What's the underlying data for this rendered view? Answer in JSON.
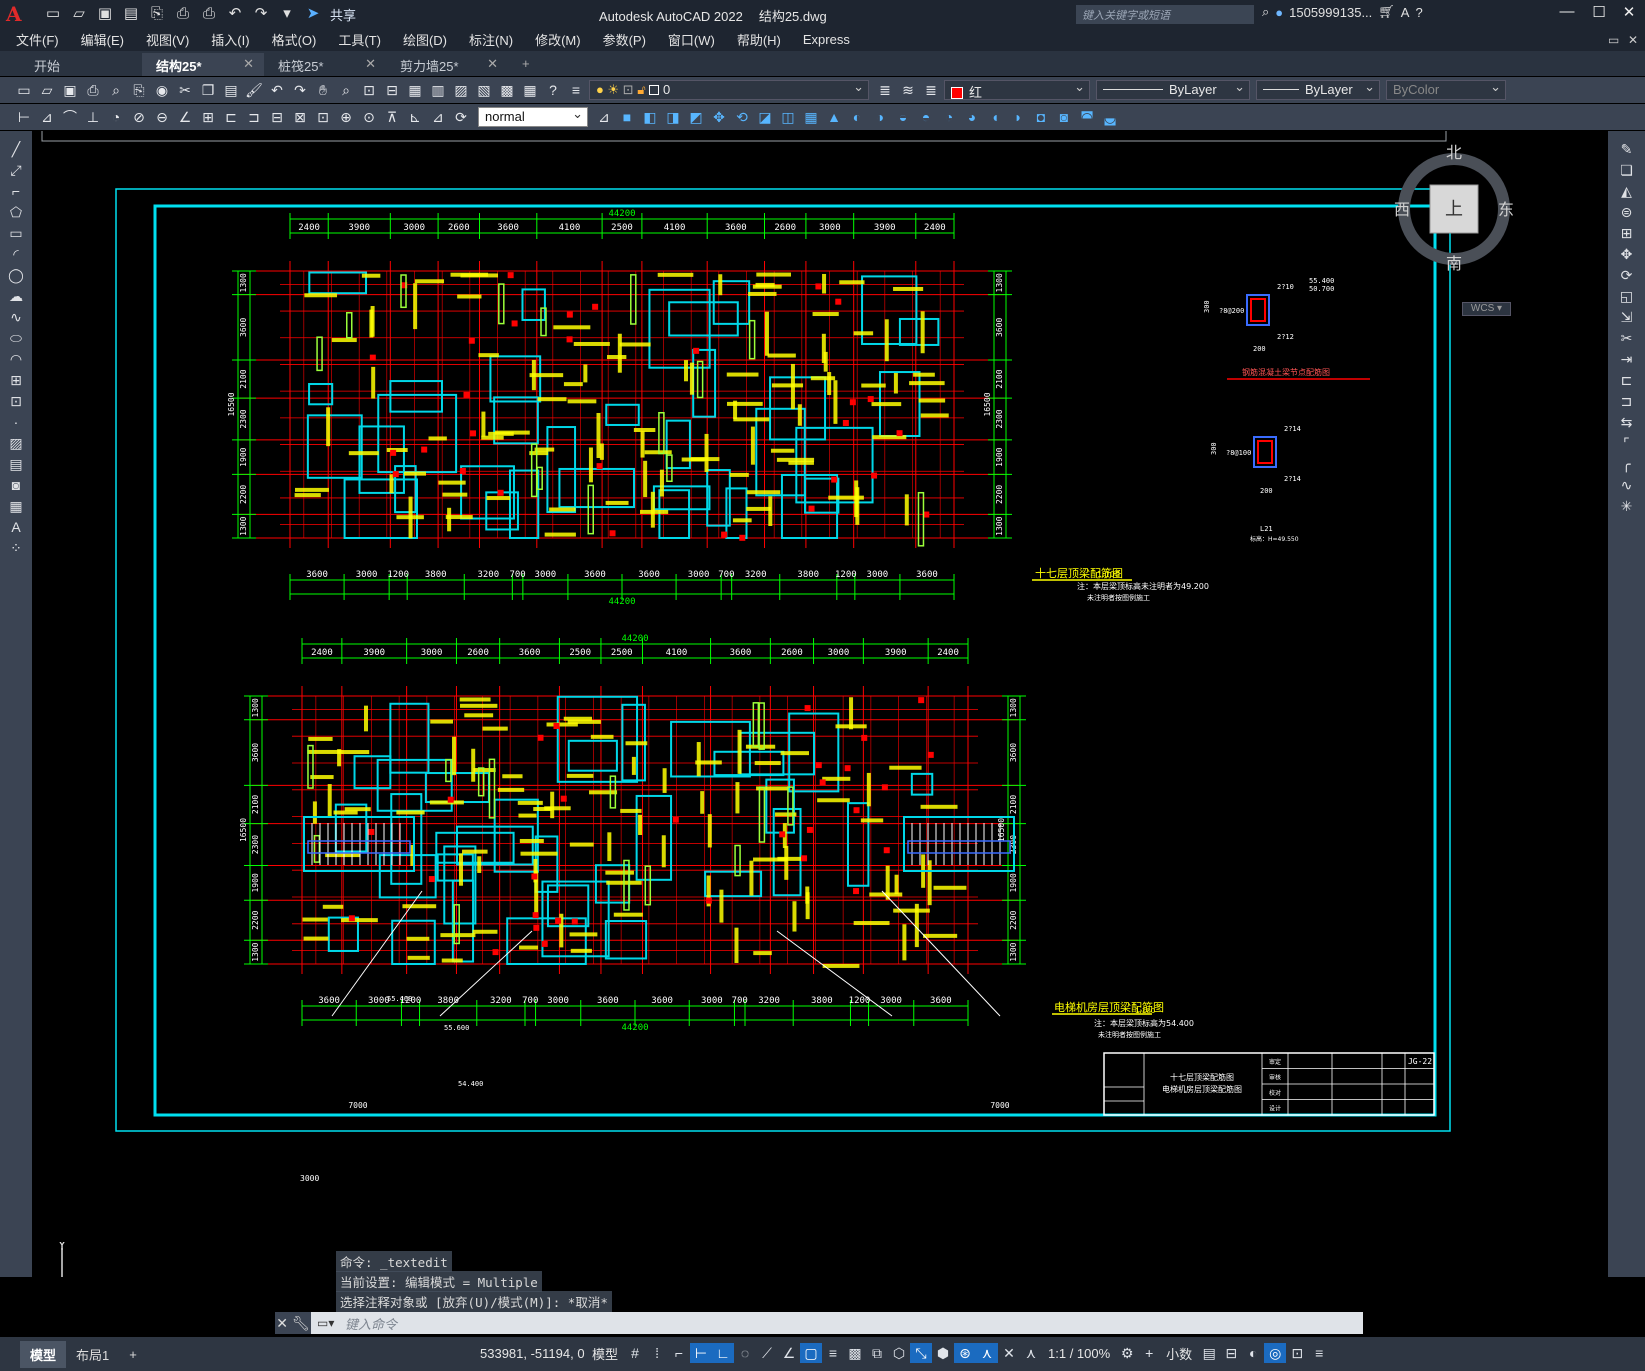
{
  "app": {
    "title": "Autodesk AutoCAD 2022",
    "file": "结构25.dwg",
    "search_placeholder": "键入关键字或短语",
    "user": "1505999135...",
    "share_label": "共享"
  },
  "menu": [
    "文件(F)",
    "编辑(E)",
    "视图(V)",
    "插入(I)",
    "格式(O)",
    "工具(T)",
    "绘图(D)",
    "标注(N)",
    "修改(M)",
    "参数(P)",
    "窗口(W)",
    "帮助(H)",
    "Express"
  ],
  "tabs": [
    {
      "label": "开始",
      "active": false,
      "closable": false
    },
    {
      "label": "结构25*",
      "active": true,
      "closable": true
    },
    {
      "label": "桩筏25*",
      "active": false,
      "closable": true
    },
    {
      "label": "剪力墙25*",
      "active": false,
      "closable": true
    }
  ],
  "toolbar": {
    "layer_value": "0",
    "color_value": "红",
    "linetype_value": "ByLayer",
    "lineweight_value": "ByLayer",
    "plotstyle_value": "ByColor",
    "textstyle_value": "normal"
  },
  "viewcube": {
    "north": "北",
    "south": "南",
    "east": "东",
    "west": "西",
    "face": "上",
    "wcs": "WCS"
  },
  "drawing": {
    "plan1_title": "十七层顶梁配筋图",
    "plan1_scale": "1:100",
    "plan1_note1": "注：本层梁顶标高未注明者为49.200",
    "plan1_note2": "未注明者按图例施工",
    "plan2_title": "电梯机房层顶梁配筋图",
    "plan2_scale": "1:100",
    "plan2_note1": "注：本层梁顶标高为54.400",
    "plan2_note2": "未注明者按图例施工",
    "overall_dim": "44200",
    "height_dim": "16500",
    "top_dims": [
      "2400",
      "3900",
      "3000",
      "2600",
      "3600",
      "4100",
      "2500",
      "4100",
      "3600",
      "2600",
      "3000",
      "3900",
      "2400"
    ],
    "bot_dims": [
      "3600",
      "3000",
      "1200",
      "3800",
      "3200",
      "700",
      "3000",
      "3600",
      "3600",
      "3000",
      "700",
      "3200",
      "3800",
      "1200",
      "3000",
      "3600"
    ],
    "side_dims": [
      "1300",
      "3600",
      "2100",
      "2300",
      "1900",
      "2200",
      "1300"
    ],
    "top_dims2": [
      "2400",
      "3900",
      "3000",
      "2600",
      "3600",
      "2500",
      "2500",
      "4100",
      "3600",
      "2600",
      "3000",
      "3900",
      "2400"
    ],
    "detail1_title": "钢筋混凝土梁节点配筋图",
    "detail1_bar_top": "2?10",
    "detail1_bar_bot": "2?12",
    "detail1_stirrup": "?8@200",
    "detail1_width": "200",
    "detail1_height": "300",
    "detail1_level": "55.400",
    "detail1_level2": "50.700",
    "detail2_bar_top": "2?14",
    "detail2_bar_bot": "2?14",
    "detail2_stirrup": "?8@100",
    "detail2_width": "200",
    "detail2_height": "300",
    "detail2_label": "L21",
    "detail2_note": "标高：H=49.550",
    "titleblock": {
      "drawing_name1": "十七层顶梁配筋图",
      "drawing_name2": "电梯机房层顶梁配筋图",
      "sheet_no": "JG-22",
      "scale_label": "比例",
      "rows": [
        "审定",
        "审核",
        "校对",
        "设计",
        "专业负责人",
        "项目负责人"
      ]
    },
    "stair_dims": [
      "3000",
      "7000",
      "55.400",
      "55.600",
      "54.400"
    ]
  },
  "command": {
    "history": [
      "命令: _textedit",
      "当前设置: 编辑模式 = Multiple",
      "选择注释对象或 [放弃(U)/模式(M)]: *取消*"
    ],
    "placeholder": "键入命令"
  },
  "status": {
    "tabs": [
      {
        "label": "模型",
        "active": true
      },
      {
        "label": "布局1",
        "active": false
      }
    ],
    "coords": "533981, -51194, 0",
    "space": "模型",
    "scale": "1:1 / 100%",
    "units": "小数"
  },
  "colors": {
    "grid_red": "#ff0000",
    "dim_green": "#00ff00",
    "wall_cyan": "#00d8e8",
    "text_yellow": "#ffff00",
    "frame_cyan": "#00e0f0",
    "ui_dark": "#1e2530",
    "ui_panel": "#3b4453"
  }
}
